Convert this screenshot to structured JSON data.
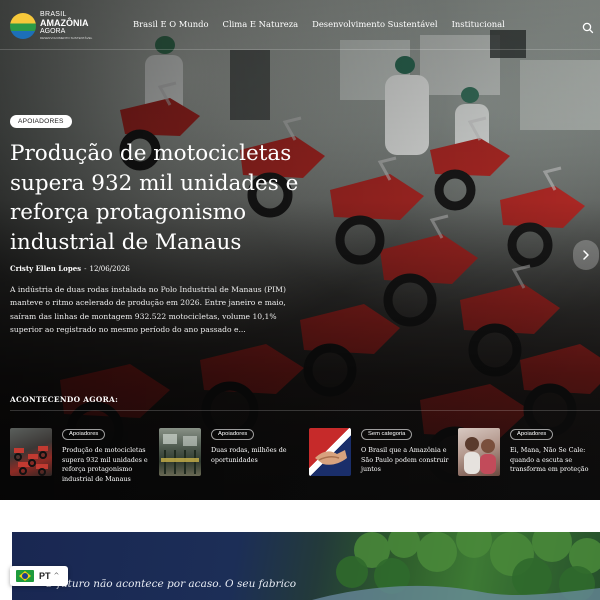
{
  "header": {
    "logo": {
      "line1": "BRASIL",
      "line2": "AMAZÔNIA",
      "line3": "AGORA",
      "line4": "DESENVOLVIMENTO SUSTENTÁVEL"
    },
    "nav": [
      {
        "label": "Brasil E O Mundo"
      },
      {
        "label": "Clima E Natureza"
      },
      {
        "label": "Desenvolvimento Sustentável"
      },
      {
        "label": "Institucional"
      }
    ]
  },
  "hero": {
    "category": "APOIADORES",
    "title": "Produção de motocicletas supera 932 mil unidades e reforça protagonismo industrial de Manaus",
    "author": "Cristy Ellen Lopes",
    "separator": "-",
    "date": "12/06/2026",
    "excerpt": "A indústria de duas rodas instalada no Polo Industrial de Manaus (PIM) manteve o ritmo acelerado de produção em 2026. Entre janeiro e maio, saíram das linhas de montagem 932.522 motocicletas, volume 10,1% superior ao registrado no mesmo período do ano passado e..."
  },
  "ticker": {
    "title": "ACONTECENDO AGORA:",
    "items": [
      {
        "category": "Apoiadores",
        "title": "Produção de motocicletas supera 932 mil unidades e reforça protagonismo industrial de Manaus"
      },
      {
        "category": "Apoiadores",
        "title": "Duas rodas, milhões de oportunidades"
      },
      {
        "category": "Sem categoria",
        "title": "O Brasil que a Amazônia e São Paulo podem construir juntos"
      },
      {
        "category": "Apoiadores",
        "title": "Ei, Mana, Não Se Cale: quando a escuta se transforma em proteção"
      }
    ]
  },
  "feature": {
    "text": "O futuro não acontece por acaso.  O seu fabrico"
  },
  "language": {
    "code": "PT"
  }
}
